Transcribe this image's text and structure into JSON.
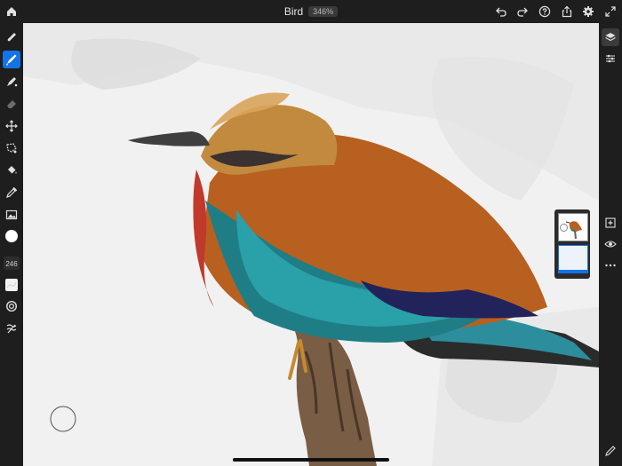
{
  "document": {
    "title": "Bird",
    "zoom": "346%"
  },
  "toolbar_left": {
    "brush_size": "246"
  },
  "colors": {
    "accent": "#1473e6",
    "chrome": "#1e1e1e",
    "current_color": "#ffffff"
  },
  "icons": {
    "top": [
      "home-icon",
      "undo-icon",
      "redo-icon",
      "help-icon",
      "share-icon",
      "settings-icon",
      "fullscreen-icon"
    ],
    "left": [
      "pixel-brush-icon",
      "live-brush-icon",
      "vector-brush-icon",
      "eraser-icon",
      "transform-icon",
      "selection-icon",
      "fill-icon",
      "eyedropper-icon",
      "image-place-icon",
      "color-swatch-icon",
      "brush-settings-icon",
      "smudge-icon",
      "modify-icon"
    ],
    "right": [
      "layers-icon",
      "layer-properties-icon",
      "add-layer-icon",
      "visibility-icon",
      "more-icon",
      "pencil-icon"
    ]
  }
}
